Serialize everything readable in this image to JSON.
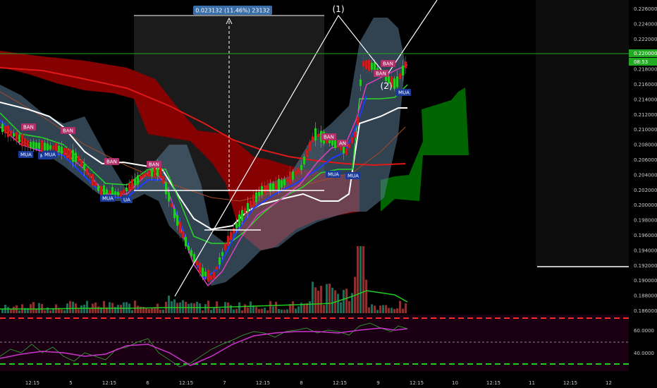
{
  "price_axis": {
    "ticks": [
      "0.226000",
      "0.224000",
      "0.222000",
      "0.220000",
      "0.218000",
      "0.216000",
      "0.214000",
      "0.212000",
      "0.210000",
      "0.208000",
      "0.206000",
      "0.204000",
      "0.202000",
      "0.200000",
      "0.198000",
      "0.196000",
      "0.194000",
      "0.192000",
      "0.190000",
      "0.188000",
      "0.186000"
    ],
    "current_price": "0.220000",
    "countdown": "08:53"
  },
  "rsi_axis": {
    "ticks": [
      "60.0000",
      "40.0000"
    ]
  },
  "time_axis": {
    "ticks": [
      "12:15",
      "5",
      "12:15",
      "6",
      "12:15",
      "7",
      "12:15",
      "8",
      "12:15",
      "9",
      "12:15",
      "10",
      "12:15",
      "11",
      "12:15",
      "12"
    ]
  },
  "measure": {
    "label": "0.023132 (11.46%) 23132"
  },
  "wave_labels": [
    "(1)",
    "(2)"
  ],
  "signals": [
    "BAN",
    "BAN",
    "MUA",
    "MUA",
    "BAN",
    "BAN",
    "MUA",
    "UA",
    "MUA",
    "BAN",
    "AN",
    "MUA",
    "MUA",
    "BAN",
    "BAN",
    "MUA"
  ],
  "colors": {
    "background": "#000000",
    "bull_candle": "#26c826",
    "bear_candle": "#c81e1e",
    "cloud_red": "#8c0000",
    "cloud_green": "#006400",
    "bollinger_fill": "#5a7a94",
    "tag_sell": "#b0306a",
    "tag_buy": "#1a3a9a",
    "rsi_bg": "#1a0012",
    "rsi_band_line": "#ff2a2a",
    "rsi_low_line": "#22cc22",
    "price_line": "#22aa22"
  }
}
